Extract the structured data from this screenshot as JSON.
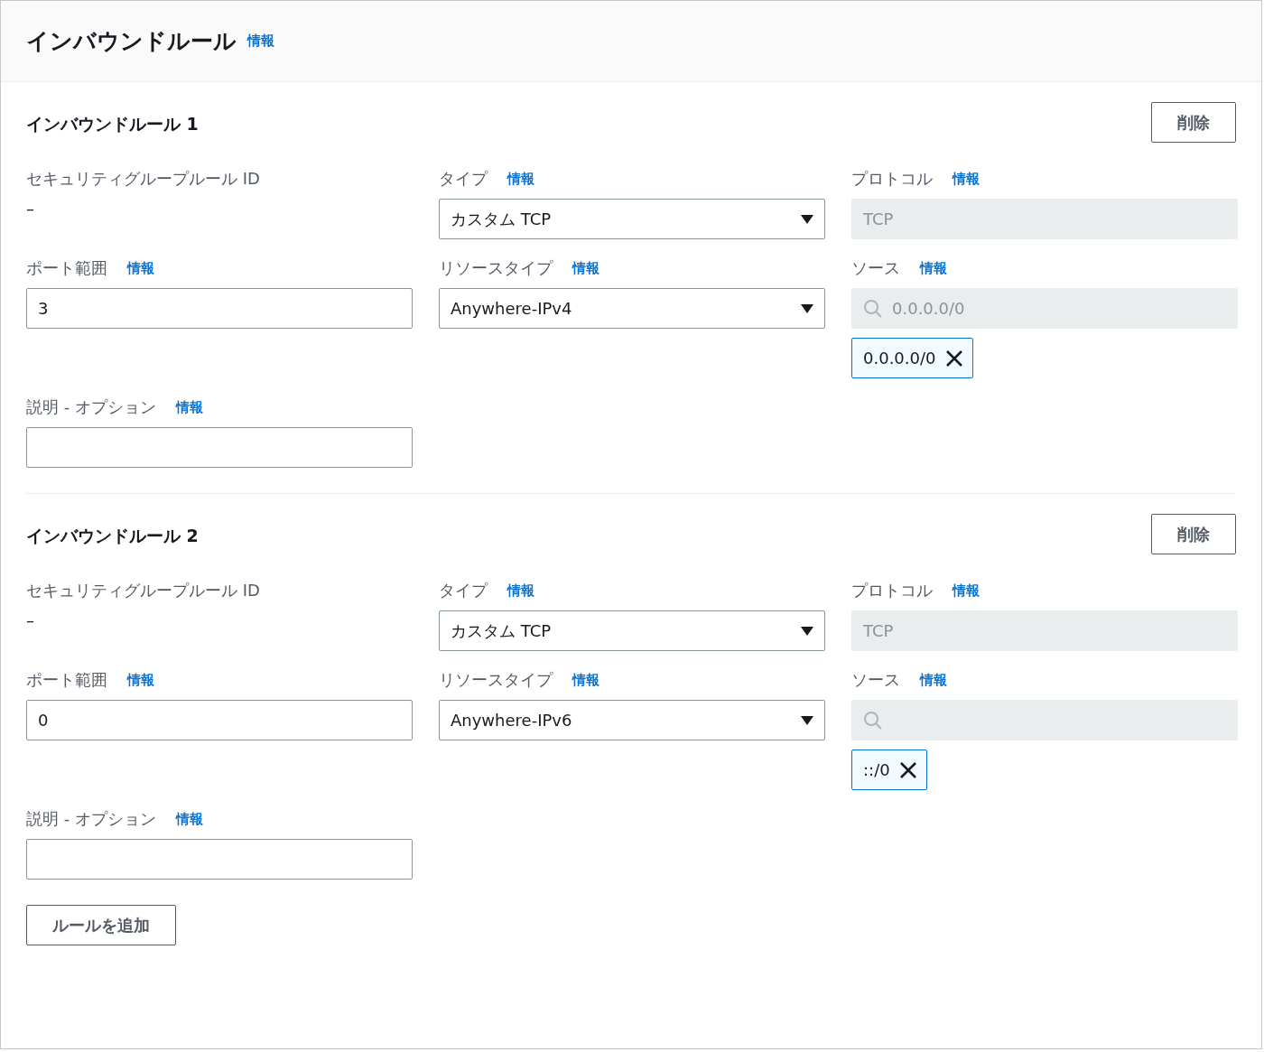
{
  "header": {
    "title": "インバウンドルール",
    "info": "情報"
  },
  "rules": [
    {
      "title": "インバウンドルール 1",
      "delete_label": "削除",
      "fields": [
        {
          "kind": "static",
          "label": "セキュリティグループルール ID",
          "value": "–"
        },
        {
          "kind": "select",
          "label": "タイプ",
          "info": "情報",
          "value": "カスタム TCP"
        },
        {
          "kind": "readonly",
          "label": "プロトコル",
          "info": "情報",
          "value": "TCP"
        },
        {
          "kind": "input",
          "label": "ポート範囲",
          "info": "情報",
          "value": "3"
        },
        {
          "kind": "select",
          "label": "リソースタイプ",
          "info": "情報",
          "value": "Anywhere-IPv4"
        },
        {
          "kind": "search",
          "label": "ソース",
          "info": "情報",
          "placeholder": "0.0.0.0/0",
          "token": "0.0.0.0/0"
        },
        {
          "kind": "input",
          "label": "説明 - オプション",
          "info": "情報"
        }
      ]
    },
    {
      "title": "インバウンドルール 2",
      "delete_label": "削除",
      "fields": [
        {
          "kind": "static",
          "label": "セキュリティグループルール ID",
          "value": "–"
        },
        {
          "kind": "select",
          "label": "タイプ",
          "info": "情報",
          "value": "カスタム TCP"
        },
        {
          "kind": "readonly",
          "label": "プロトコル",
          "info": "情報",
          "value": "TCP"
        },
        {
          "kind": "input",
          "label": "ポート範囲",
          "info": "情報",
          "value": "0"
        },
        {
          "kind": "select",
          "label": "リソースタイプ",
          "info": "情報",
          "value": "Anywhere-IPv6"
        },
        {
          "kind": "search",
          "label": "ソース",
          "info": "情報",
          "token": "::/0"
        },
        {
          "kind": "input",
          "label": "説明 - オプション",
          "info": "情報"
        }
      ]
    }
  ],
  "add_rule_label": "ルールを追加"
}
